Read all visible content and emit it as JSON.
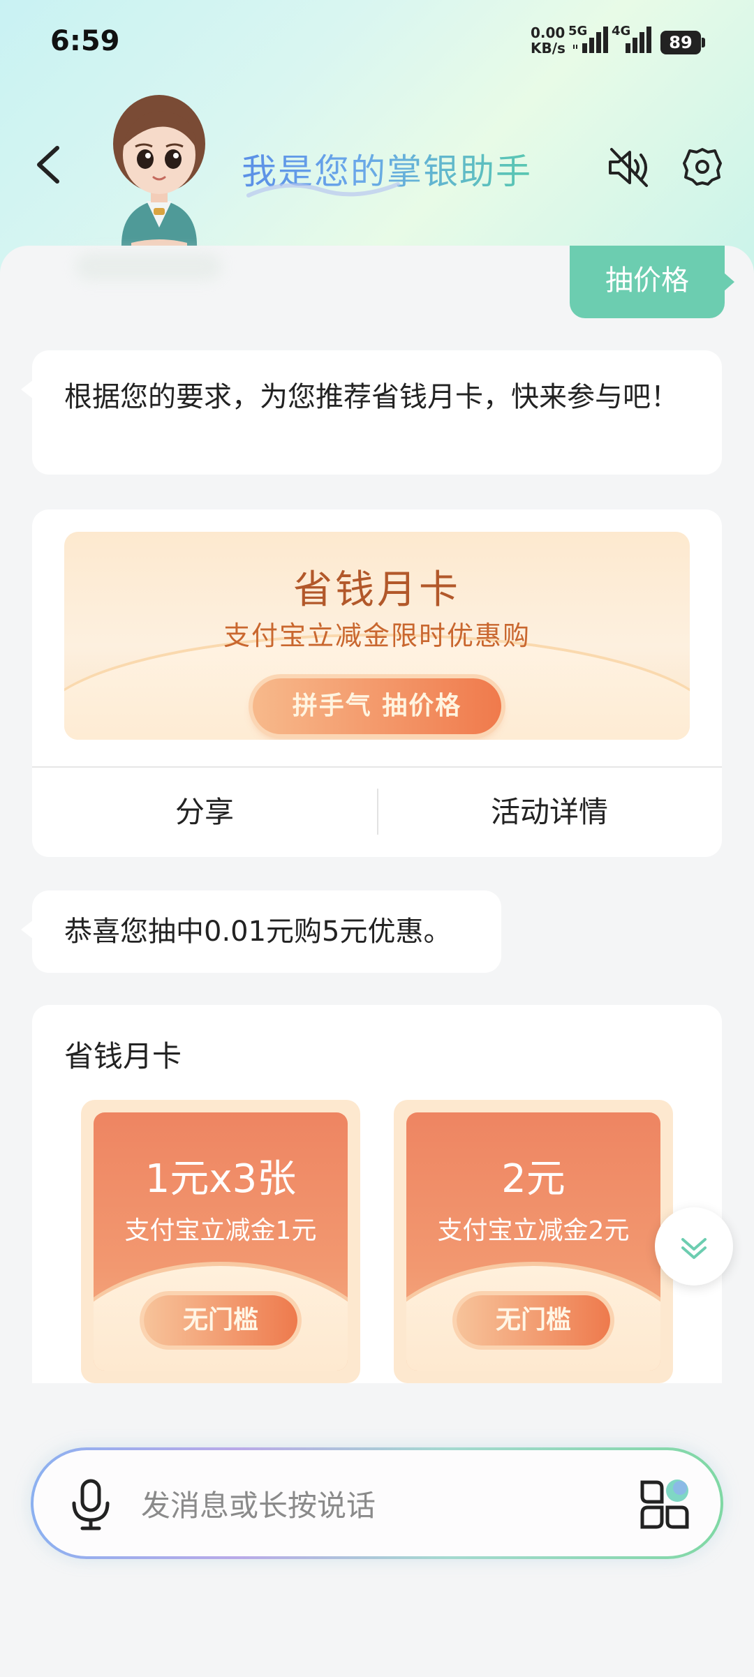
{
  "status_bar": {
    "time": "6:59",
    "net_speed_value": "0.00",
    "net_speed_unit": "KB/s",
    "signal_1_label": "5G",
    "signal_2_label": "4G",
    "battery": "89"
  },
  "header": {
    "title": "我是您的掌银助手"
  },
  "chat": {
    "user_message": "抽价格",
    "bot_message_1": "根据您的要求，为您推荐省钱月卡，快来参与吧！",
    "promo_card": {
      "title": "省钱月卡",
      "subtitle": "支付宝立减金限时优惠购",
      "button": "拼手气 抽价格",
      "share": "分享",
      "details": "活动详情"
    },
    "bot_message_2": "恭喜您抽中0.01元购5元优惠。",
    "coupon_card": {
      "title": "省钱月卡",
      "coupons": [
        {
          "amount": "1元x3张",
          "desc": "支付宝立减金1元",
          "button": "无门槛"
        },
        {
          "amount": "2元",
          "desc": "支付宝立减金2元",
          "button": "无门槛"
        }
      ]
    }
  },
  "input": {
    "placeholder": "发消息或长按说话"
  }
}
